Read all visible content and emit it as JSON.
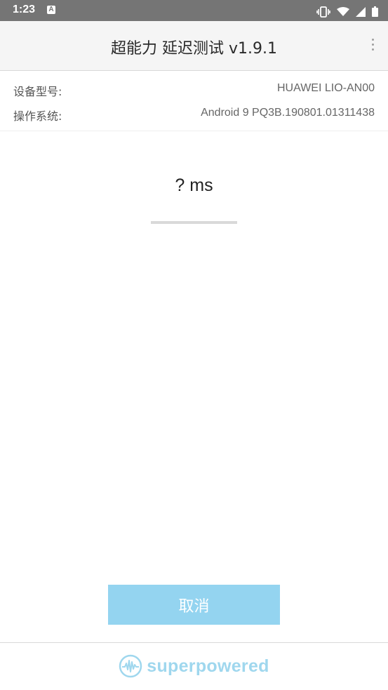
{
  "status_bar": {
    "time": "1:23",
    "notification_badge": "A",
    "icons": [
      "vibrate-icon",
      "wifi-icon",
      "signal-icon",
      "battery-icon"
    ]
  },
  "app_bar": {
    "title": "超能力 延迟测试 v1.9.1",
    "menu_icon": "more-vert-icon"
  },
  "device_info": {
    "model_label": "设备型号:",
    "model_value": "HUAWEI LIO-AN00",
    "os_label": "操作系统:",
    "os_value": "Android 9 PQ3B.190801.01311438"
  },
  "result": {
    "latency": "? ms",
    "progress": 0
  },
  "actions": {
    "cancel_label": "取消"
  },
  "footer": {
    "logo_text": "superpowered",
    "logo_icon": "waveform-circle-icon"
  },
  "colors": {
    "status_bar": "#757575",
    "app_bar": "#f5f5f5",
    "accent": "#94d4f0",
    "logo": "#9fd7ee"
  }
}
